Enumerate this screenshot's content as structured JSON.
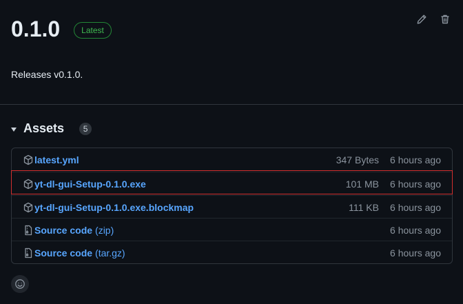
{
  "release": {
    "title": "0.1.0",
    "badge": "Latest",
    "notes": "Releases v0.1.0."
  },
  "actions": {
    "edit_icon": "pencil-icon",
    "delete_icon": "trash-icon"
  },
  "assets": {
    "title": "Assets",
    "count": "5",
    "rows": [
      {
        "name": "latest.yml",
        "suffix": "",
        "size": "347 Bytes",
        "time": "6 hours ago",
        "icon": "package-icon"
      },
      {
        "name": "yt-dl-gui-Setup-0.1.0.exe",
        "suffix": "",
        "size": "101 MB",
        "time": "6 hours ago",
        "icon": "package-icon"
      },
      {
        "name": "yt-dl-gui-Setup-0.1.0.exe.blockmap",
        "suffix": "",
        "size": "111 KB",
        "time": "6 hours ago",
        "icon": "package-icon"
      },
      {
        "name": "Source code",
        "suffix": "(zip)",
        "size": "",
        "time": "6 hours ago",
        "icon": "file-zip-icon"
      },
      {
        "name": "Source code",
        "suffix": "(tar.gz)",
        "size": "",
        "time": "6 hours ago",
        "icon": "file-zip-icon"
      }
    ]
  },
  "colors": {
    "background": "#0d1117",
    "link": "#58a6ff",
    "badge_green": "#3fb950",
    "highlight_red": "#d32f2f"
  }
}
